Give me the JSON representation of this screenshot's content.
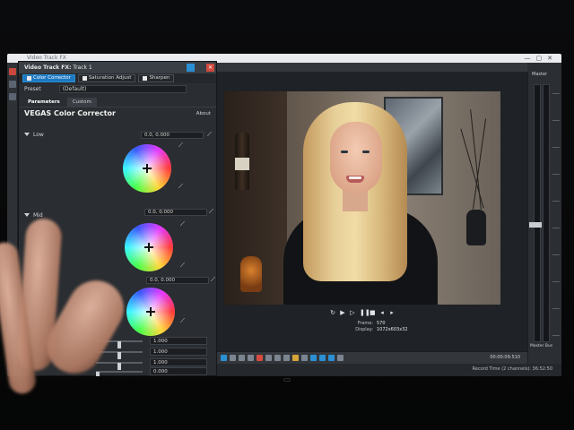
{
  "host": {
    "window_title": "Video Track FX"
  },
  "fx_dialog": {
    "title": "Video Track FX:",
    "subtitle": "Track 1",
    "chain": [
      {
        "label": "Color Corrector",
        "active": true
      },
      {
        "label": "Saturation Adjust",
        "active": false
      },
      {
        "label": "Sharpen",
        "active": false
      }
    ],
    "preset_label": "Preset",
    "preset_value": "(Default)",
    "tabs": [
      "Parameters",
      "Custom"
    ],
    "plugin_name": "VEGAS Color Corrector",
    "about_label": "About",
    "low_label": "Low",
    "low_value": "0.0, 0.000",
    "mid_label": "Mid",
    "mid_value": "0.0, 0.000",
    "high_value": "0.0, 0.000",
    "sliders": [
      {
        "value": "1.000",
        "level": 0.5
      },
      {
        "value": "1.000",
        "level": 0.5
      },
      {
        "value": "1.000",
        "level": 0.5
      },
      {
        "value": "0.000",
        "level": 0.0
      }
    ]
  },
  "preview": {
    "frame_label": "Frame:",
    "frame_value": "570",
    "display_label": "Display:",
    "display_value": "1072x603x32"
  },
  "master": {
    "title": "Master",
    "bus_label": "Master Bus"
  },
  "timeline": {
    "time": "00:00:09:510"
  },
  "status": {
    "record_time": "Record Time (2 channels): 36:52:50"
  },
  "icons": {
    "close": "close-icon",
    "picker": "eyedropper-icon",
    "play": "play-icon",
    "stop": "stop-icon",
    "pause": "pause-icon"
  },
  "colors": {
    "accent": "#1d78c1",
    "close": "#d24a3e",
    "panel": "#2a2d31"
  }
}
